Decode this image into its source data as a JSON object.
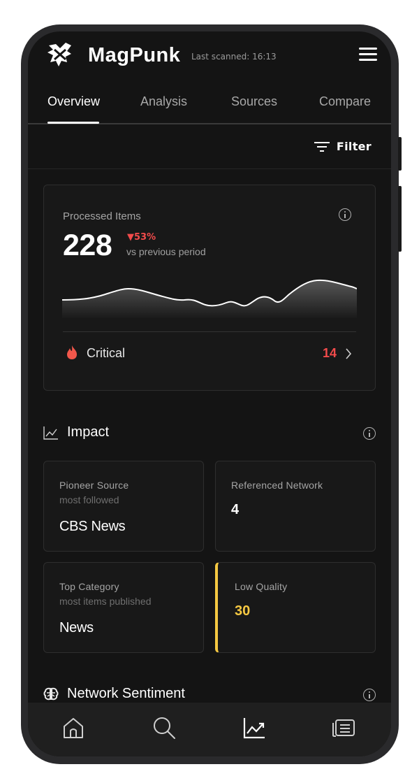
{
  "app": {
    "brand": "MagPunk",
    "last_scanned": "Last scanned: 16:13"
  },
  "tabs": [
    {
      "label": "Overview",
      "active": true
    },
    {
      "label": "Analysis",
      "active": false
    },
    {
      "label": "Sources",
      "active": false
    },
    {
      "label": "Compare",
      "active": false
    }
  ],
  "filter": {
    "label": "Filter"
  },
  "processed": {
    "label": "Processed Items",
    "value": "228",
    "delta": "▼53%",
    "delta_note": "vs previous period",
    "critical_label": "Critical",
    "critical_count": "14"
  },
  "impact": {
    "title": "Impact",
    "cards": [
      {
        "title": "Pioneer Source",
        "sub": "most followed",
        "value": "CBS News"
      },
      {
        "title": "Referenced Network",
        "value": "4"
      },
      {
        "title": "Top Category",
        "sub": "most items published",
        "value": "News"
      },
      {
        "title": "Low Quality",
        "value": "30"
      }
    ]
  },
  "sentiment": {
    "title": "Network Sentiment"
  },
  "nav": [
    "home-icon",
    "search-icon",
    "trend-chart-icon",
    "news-feed-icon"
  ],
  "colors": {
    "accent_red": "#f24b4b",
    "accent_yellow": "#f5c842",
    "background": "#141414"
  }
}
